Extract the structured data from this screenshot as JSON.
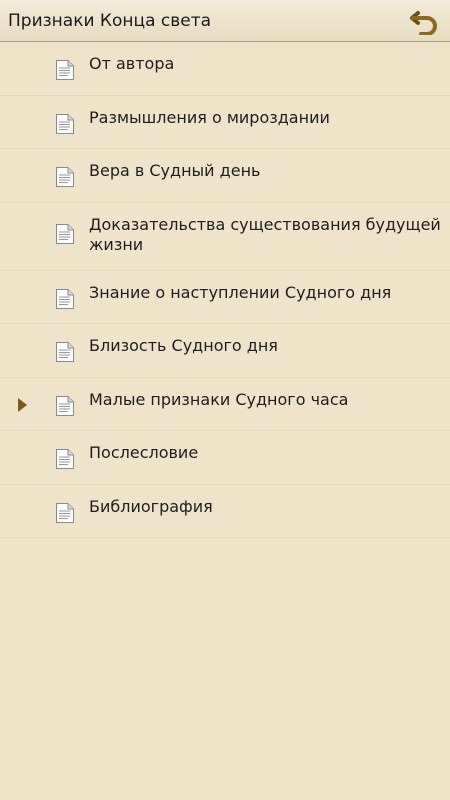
{
  "header": {
    "title": "Признаки Конца света",
    "back_icon": "back-arrow-icon",
    "accent_color": "#8b6a1f"
  },
  "toc": {
    "items": [
      {
        "label": "От автора",
        "current": false
      },
      {
        "label": "Размышления о мироздании",
        "current": false
      },
      {
        "label": "Вера в Судный день",
        "current": false
      },
      {
        "label": "Доказательства существования будущей жизни",
        "current": false
      },
      {
        "label": "Знание о наступлении Судного дня",
        "current": false
      },
      {
        "label": "Близость Судного дня",
        "current": false
      },
      {
        "label": "Малые признаки Судного часа",
        "current": true
      },
      {
        "label": "Послесловие",
        "current": false
      },
      {
        "label": "Библиография",
        "current": false
      }
    ],
    "item_icon": "document-icon"
  },
  "colors": {
    "background": "#efe3c9",
    "header_background": "#eae0c8",
    "separator": "#e2d6bd",
    "current_marker": "#7a5a17"
  }
}
